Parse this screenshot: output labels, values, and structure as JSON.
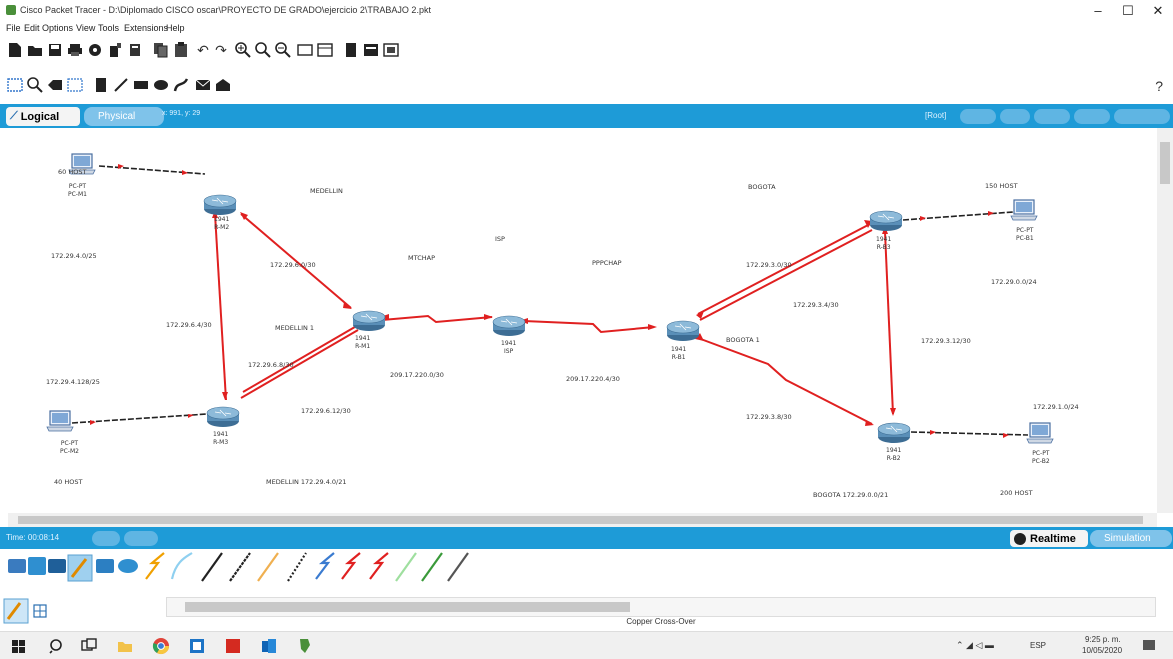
{
  "window": {
    "title": "Cisco Packet Tracer - D:\\Diplomado CISCO oscar\\PROYECTO DE GRADO\\ejercicio 2\\TRABAJO 2.pkt",
    "min": "–",
    "max": "☐",
    "close": "✕"
  },
  "menu": [
    "File",
    "Edit",
    "Options",
    "View",
    "Tools",
    "Extensions",
    "Help"
  ],
  "help_label": "?",
  "tabs": {
    "logical": "Logical",
    "physical": "Physical",
    "coords": "x: 991, y: 29",
    "root": "[Root]"
  },
  "canvas_labels": {
    "medellin": "MEDELLIN",
    "bogota": "BOGOTA",
    "isp_area": "ISP",
    "ppp_chap": "PPPCHAP",
    "mtchap": "MTCHAP",
    "net_medellin1": "MEDELLIN 1",
    "net_bogota1": "BOGOTA 1",
    "net_r_m1_m2": "172.29.6.0/30",
    "net_r_m2_m3": "172.29.6.4/30",
    "net_r_m1_m3": "172.29.6.8/30",
    "net_m3_extra": "172.29.6.12/30",
    "net_isp_m1": "209.17.220.0/30",
    "net_isp_b1": "209.17.220.4/30",
    "net_b1_b3": "172.29.3.0/30",
    "net_b3_b2": "172.29.3.4/30",
    "net_b3_extra": "172.29.3.12/30",
    "net_b1_b2": "172.29.3.8/30",
    "lan_pc_m1": "172.29.4.0/25",
    "lan_pc_m2": "172.29.4.128/25",
    "lan_pc_b1": "172.29.0.0/24",
    "lan_pc_b2": "172.29.1.0/24",
    "hosts_m1": "60 HOST",
    "hosts_m2": "40 HOST",
    "hosts_b1": "150 HOST",
    "hosts_b2": "200 HOST",
    "summary_medellin": "MEDELLIN 172.29.4.0/21",
    "summary_bogota": "BOGOTA 172.29.0.0/21"
  },
  "devices": {
    "pc_m1": [
      "PC-PT",
      "PC-M1"
    ],
    "pc_m2": [
      "PC-PT",
      "PC-M2"
    ],
    "pc_b1": [
      "PC-PT",
      "PC-B1"
    ],
    "pc_b2": [
      "PC-PT",
      "PC-B2"
    ],
    "r_m2": [
      "1941",
      "R-M2"
    ],
    "r_m1": [
      "1941",
      "R-M1"
    ],
    "r_m3": [
      "1941",
      "R-M3"
    ],
    "isp": [
      "1941",
      "ISP"
    ],
    "r_b1": [
      "1941",
      "R-B1"
    ],
    "r_b3": [
      "1941",
      "R-B3"
    ],
    "r_b2": [
      "1941",
      "R-B2"
    ]
  },
  "bottom": {
    "time": "Time: 00:08:14",
    "realtime": "Realtime",
    "simulation": "Simulation",
    "status": "Copper Cross-Over"
  },
  "taskbar": {
    "lang": "ESP",
    "time": "9:25 p. m.",
    "date": "10/05/2020"
  },
  "colors": {
    "accent": "#1e9bd7",
    "link_red": "#e02020",
    "router_blue": "#5a8fb8"
  }
}
